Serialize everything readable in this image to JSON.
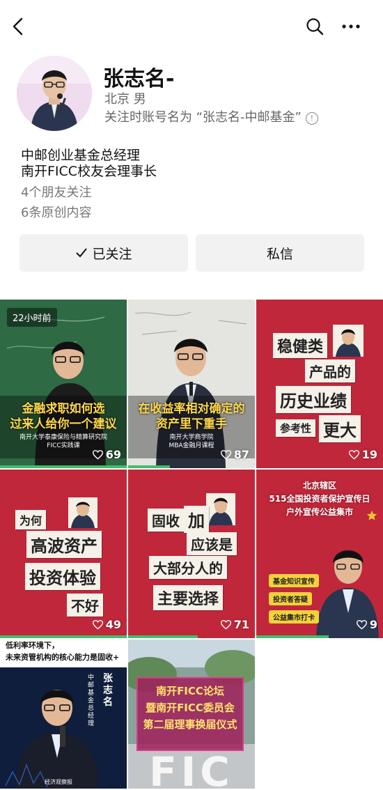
{
  "profile": {
    "name": "张志名-",
    "location_gender": "北京 男",
    "follow_name_note": "关注时账号名为 “张志名-中邮基金”",
    "bio_line1": "中邮创业基金总经理",
    "bio_line2": "南开FICC校友会理事长",
    "friends_following": "4个朋友关注",
    "original_content": "6条原创内容"
  },
  "actions": {
    "followed_label": "已关注",
    "message_label": "私信"
  },
  "icons": [
    "back-icon",
    "search-icon",
    "more-icon",
    "check-icon",
    "heart-icon",
    "info-icon"
  ],
  "colors": {
    "accent_red": "#c0273a",
    "progress_green": "#3fbf6a"
  },
  "videos": [
    {
      "badge": "22小时前",
      "caption": "金融求职如何选\n过来人给你一个建议",
      "sub": "南开大学泰康保险与精算研究院\nFICC实践课",
      "likes": "69"
    },
    {
      "caption": "在收益率相对确定的\n资产里下重手",
      "sub": "南开大学商学院\nMBA金融月课程",
      "likes": "87"
    },
    {
      "words": [
        "稳健类",
        "产品的",
        "历史业绩",
        "参考性",
        "更大"
      ],
      "likes": "19"
    },
    {
      "words": [
        "为何",
        "高波资产",
        "投资体验",
        "不好"
      ],
      "likes": "49"
    },
    {
      "words": [
        "固收",
        "加",
        "应该是",
        "大部分人的",
        "主要选择"
      ],
      "likes": "71"
    },
    {
      "title": "北京辖区\n515全国投资者保护宣传日\n户外宣传公益集市",
      "tags": [
        "基金知识宣传",
        "投资者答疑",
        "公益集市打卡"
      ],
      "likes": "9"
    },
    {
      "title": "低利率环境下，\n未来资管机构的核心能力是固收+",
      "side_name": "张志名",
      "side_title": "中邮基金总经理",
      "source": "经济观察报"
    },
    {
      "title": "南开FICC论坛\n暨南开FICC委员会\n第二届理事换届仪式",
      "watermark": "FIC"
    }
  ]
}
